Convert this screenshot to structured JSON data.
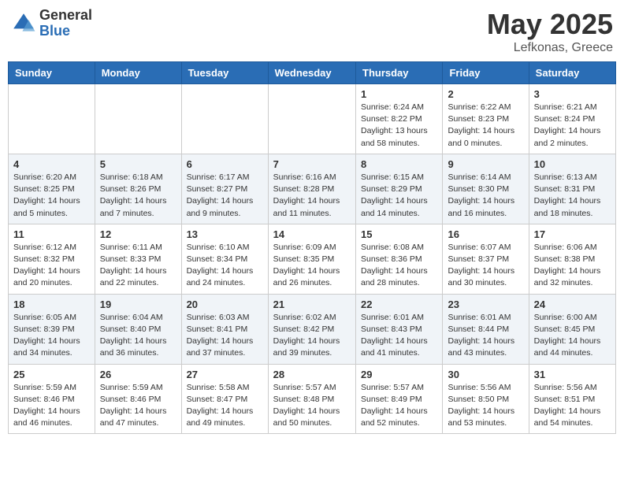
{
  "header": {
    "logo_general": "General",
    "logo_blue": "Blue",
    "title": "May 2025",
    "location": "Lefkonas, Greece"
  },
  "days_of_week": [
    "Sunday",
    "Monday",
    "Tuesday",
    "Wednesday",
    "Thursday",
    "Friday",
    "Saturday"
  ],
  "weeks": [
    [
      {
        "day": "",
        "info": ""
      },
      {
        "day": "",
        "info": ""
      },
      {
        "day": "",
        "info": ""
      },
      {
        "day": "",
        "info": ""
      },
      {
        "day": "1",
        "info": "Sunrise: 6:24 AM\nSunset: 8:22 PM\nDaylight: 13 hours\nand 58 minutes."
      },
      {
        "day": "2",
        "info": "Sunrise: 6:22 AM\nSunset: 8:23 PM\nDaylight: 14 hours\nand 0 minutes."
      },
      {
        "day": "3",
        "info": "Sunrise: 6:21 AM\nSunset: 8:24 PM\nDaylight: 14 hours\nand 2 minutes."
      }
    ],
    [
      {
        "day": "4",
        "info": "Sunrise: 6:20 AM\nSunset: 8:25 PM\nDaylight: 14 hours\nand 5 minutes."
      },
      {
        "day": "5",
        "info": "Sunrise: 6:18 AM\nSunset: 8:26 PM\nDaylight: 14 hours\nand 7 minutes."
      },
      {
        "day": "6",
        "info": "Sunrise: 6:17 AM\nSunset: 8:27 PM\nDaylight: 14 hours\nand 9 minutes."
      },
      {
        "day": "7",
        "info": "Sunrise: 6:16 AM\nSunset: 8:28 PM\nDaylight: 14 hours\nand 11 minutes."
      },
      {
        "day": "8",
        "info": "Sunrise: 6:15 AM\nSunset: 8:29 PM\nDaylight: 14 hours\nand 14 minutes."
      },
      {
        "day": "9",
        "info": "Sunrise: 6:14 AM\nSunset: 8:30 PM\nDaylight: 14 hours\nand 16 minutes."
      },
      {
        "day": "10",
        "info": "Sunrise: 6:13 AM\nSunset: 8:31 PM\nDaylight: 14 hours\nand 18 minutes."
      }
    ],
    [
      {
        "day": "11",
        "info": "Sunrise: 6:12 AM\nSunset: 8:32 PM\nDaylight: 14 hours\nand 20 minutes."
      },
      {
        "day": "12",
        "info": "Sunrise: 6:11 AM\nSunset: 8:33 PM\nDaylight: 14 hours\nand 22 minutes."
      },
      {
        "day": "13",
        "info": "Sunrise: 6:10 AM\nSunset: 8:34 PM\nDaylight: 14 hours\nand 24 minutes."
      },
      {
        "day": "14",
        "info": "Sunrise: 6:09 AM\nSunset: 8:35 PM\nDaylight: 14 hours\nand 26 minutes."
      },
      {
        "day": "15",
        "info": "Sunrise: 6:08 AM\nSunset: 8:36 PM\nDaylight: 14 hours\nand 28 minutes."
      },
      {
        "day": "16",
        "info": "Sunrise: 6:07 AM\nSunset: 8:37 PM\nDaylight: 14 hours\nand 30 minutes."
      },
      {
        "day": "17",
        "info": "Sunrise: 6:06 AM\nSunset: 8:38 PM\nDaylight: 14 hours\nand 32 minutes."
      }
    ],
    [
      {
        "day": "18",
        "info": "Sunrise: 6:05 AM\nSunset: 8:39 PM\nDaylight: 14 hours\nand 34 minutes."
      },
      {
        "day": "19",
        "info": "Sunrise: 6:04 AM\nSunset: 8:40 PM\nDaylight: 14 hours\nand 36 minutes."
      },
      {
        "day": "20",
        "info": "Sunrise: 6:03 AM\nSunset: 8:41 PM\nDaylight: 14 hours\nand 37 minutes."
      },
      {
        "day": "21",
        "info": "Sunrise: 6:02 AM\nSunset: 8:42 PM\nDaylight: 14 hours\nand 39 minutes."
      },
      {
        "day": "22",
        "info": "Sunrise: 6:01 AM\nSunset: 8:43 PM\nDaylight: 14 hours\nand 41 minutes."
      },
      {
        "day": "23",
        "info": "Sunrise: 6:01 AM\nSunset: 8:44 PM\nDaylight: 14 hours\nand 43 minutes."
      },
      {
        "day": "24",
        "info": "Sunrise: 6:00 AM\nSunset: 8:45 PM\nDaylight: 14 hours\nand 44 minutes."
      }
    ],
    [
      {
        "day": "25",
        "info": "Sunrise: 5:59 AM\nSunset: 8:46 PM\nDaylight: 14 hours\nand 46 minutes."
      },
      {
        "day": "26",
        "info": "Sunrise: 5:59 AM\nSunset: 8:46 PM\nDaylight: 14 hours\nand 47 minutes."
      },
      {
        "day": "27",
        "info": "Sunrise: 5:58 AM\nSunset: 8:47 PM\nDaylight: 14 hours\nand 49 minutes."
      },
      {
        "day": "28",
        "info": "Sunrise: 5:57 AM\nSunset: 8:48 PM\nDaylight: 14 hours\nand 50 minutes."
      },
      {
        "day": "29",
        "info": "Sunrise: 5:57 AM\nSunset: 8:49 PM\nDaylight: 14 hours\nand 52 minutes."
      },
      {
        "day": "30",
        "info": "Sunrise: 5:56 AM\nSunset: 8:50 PM\nDaylight: 14 hours\nand 53 minutes."
      },
      {
        "day": "31",
        "info": "Sunrise: 5:56 AM\nSunset: 8:51 PM\nDaylight: 14 hours\nand 54 minutes."
      }
    ]
  ]
}
